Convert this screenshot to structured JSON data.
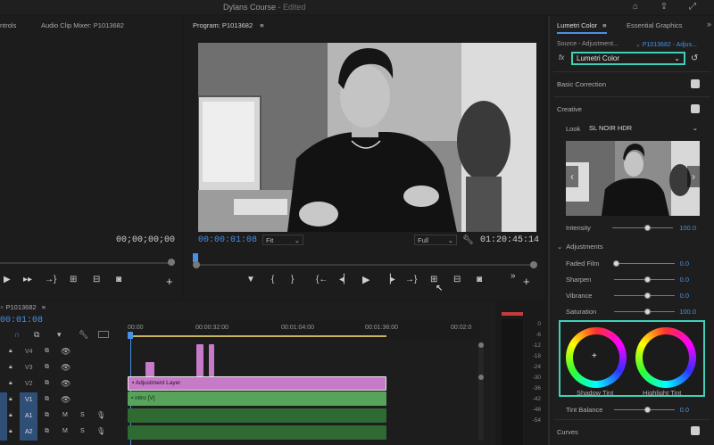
{
  "titlebar": {
    "title": "Dylans Course",
    "edited": " - Edited"
  },
  "source": {
    "tab1": "ntrols",
    "tab2": "Audio Clip Mixer: P1013682",
    "timecode": "00;00;00;00"
  },
  "program": {
    "tab": "Program: P1013682",
    "timecode": "00:00:01:08",
    "fit": "Fit",
    "full": "Full",
    "duration": "01:20:45:14"
  },
  "lumetri": {
    "tab": "Lumetri Color",
    "tab2": "Essential Graphics",
    "source_label": "Source - Adjustment...",
    "source_clip": "P1013682 - Adjus...",
    "fx": "fx",
    "effect": "Lumetri Color",
    "basic_correction": "Basic Correction",
    "creative": "Creative",
    "look_label": "Look",
    "look_value": "SL NOIR HDR",
    "intensity_label": "Intensity",
    "intensity_value": "100.0",
    "adjustments": "Adjustments",
    "faded_film_label": "Faded Film",
    "faded_film_value": "0.0",
    "sharpen_label": "Sharpen",
    "sharpen_value": "0.0",
    "vibrance_label": "Vibrance",
    "vibrance_value": "0.0",
    "saturation_label": "Saturation",
    "saturation_value": "100.0",
    "shadow_tint": "Shadow Tint",
    "highlight_tint": "Highlight Tint",
    "tint_balance_label": "Tint Balance",
    "tint_balance_value": "0.0",
    "curves": "Curves"
  },
  "timeline": {
    "tab": "P1013682",
    "timecode": "00:01:08",
    "ruler": [
      "00:00",
      "00:00:32:00",
      "00:01:04:00",
      "00:01:36:00",
      "00:02:0"
    ],
    "tracks": [
      "V4",
      "V3",
      "V2",
      "V1",
      "A1",
      "A2"
    ],
    "clip_adjustment": "Adjustment Layer",
    "clip_intro": "intro [V]"
  },
  "meter_ticks": [
    "0",
    "-6",
    "-12",
    "-18",
    "-24",
    "-30",
    "-36",
    "-42",
    "-48",
    "-54"
  ],
  "colors": {
    "accent": "#4a90e2",
    "highlight_box": "#3fd1b8",
    "adjustment_clip": "#c77ac7",
    "video_clip": "#58a35c"
  }
}
